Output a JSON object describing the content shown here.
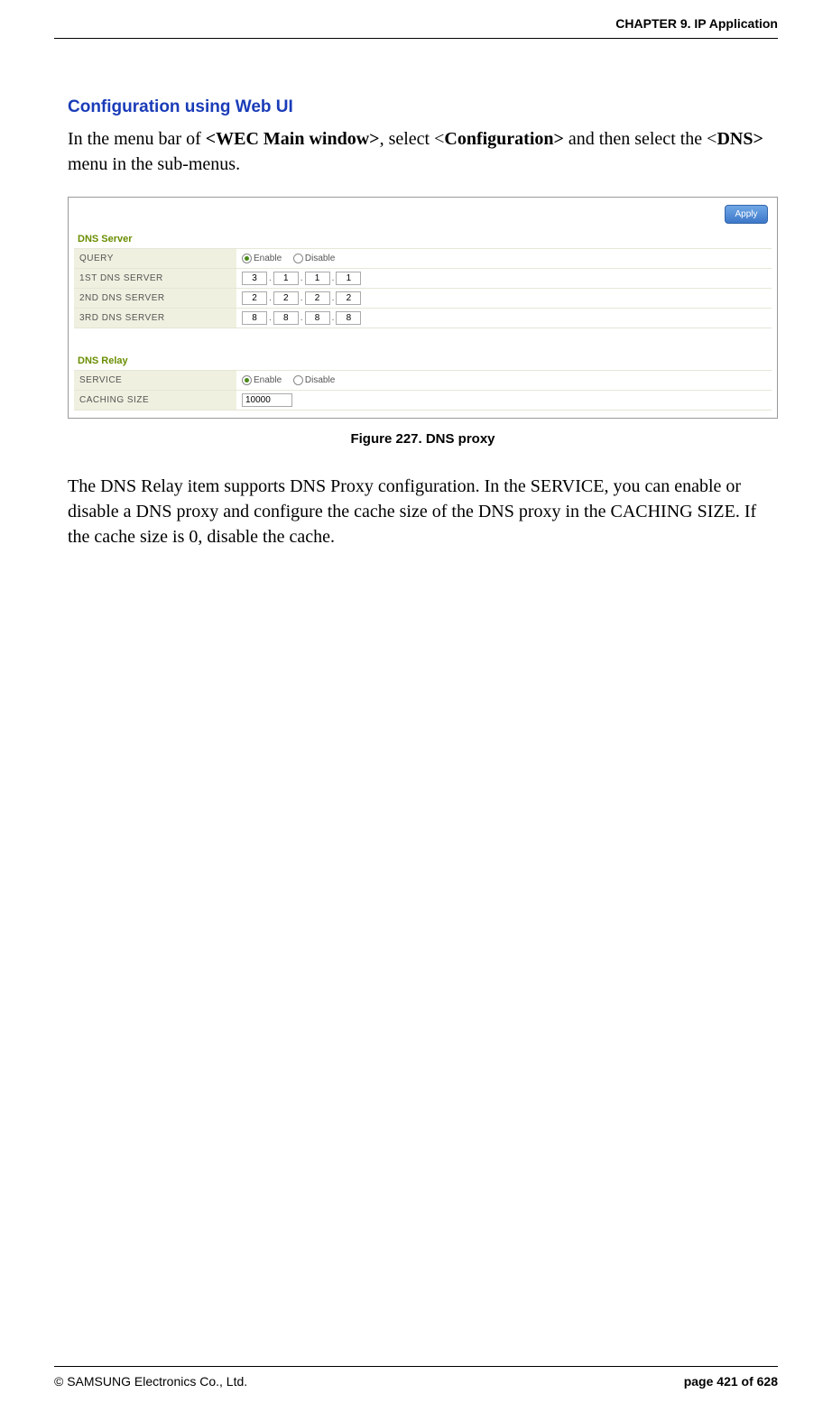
{
  "header": {
    "chapter": "CHAPTER 9. IP Application"
  },
  "section": {
    "heading": "Configuration using Web UI",
    "intro_prefix": "In the menu bar of ",
    "wec": "<WEC Main window>",
    "intro_mid": ", select <",
    "conf": "Configuration>",
    "intro_mid2": " and then select the <",
    "dns": "DNS>",
    "intro_suffix": " menu in the sub-menus."
  },
  "screenshot": {
    "apply": "Apply",
    "dns_server_label": "DNS Server",
    "query_label": "QUERY",
    "enable": "Enable",
    "disable": "Disable",
    "row_1st": "1ST DNS SERVER",
    "row_2nd": "2ND DNS SERVER",
    "row_3rd": "3RD DNS SERVER",
    "ip1": [
      "3",
      "1",
      "1",
      "1"
    ],
    "ip2": [
      "2",
      "2",
      "2",
      "2"
    ],
    "ip3": [
      "8",
      "8",
      "8",
      "8"
    ],
    "dns_relay_label": "DNS Relay",
    "service_label": "SERVICE",
    "caching_label": "CACHING SIZE",
    "caching_value": "10000"
  },
  "figure_caption": "Figure 227. DNS proxy",
  "body_para": "The DNS Relay item supports DNS Proxy configuration. In the SERVICE, you can enable or disable a DNS proxy and configure the cache size of the DNS proxy in the CACHING SIZE. If the cache size is 0, disable the cache.",
  "footer": {
    "copyright": "© SAMSUNG Electronics Co., Ltd.",
    "page": "page 421 of 628"
  }
}
